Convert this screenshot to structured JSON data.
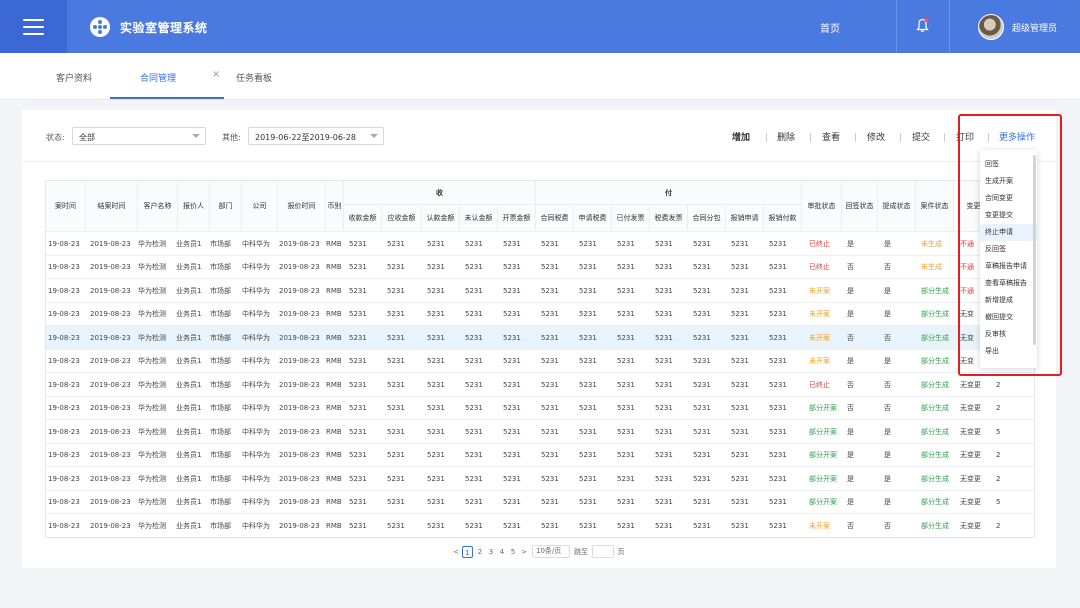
{
  "header": {
    "app_title": "实验室管理系统",
    "home": "首页",
    "user_name": "超级管理员",
    "colors": {
      "primary": "#4a7adf",
      "menu_bg": "#3b68d4",
      "accent": "#3b6fdc"
    }
  },
  "tabs": [
    {
      "label": "客户资料"
    },
    {
      "label": "合同管理",
      "active": true
    },
    {
      "label": "任务看板"
    }
  ],
  "tab_close": "×",
  "filters": {
    "status_label": "状态:",
    "status_value": "全部",
    "other_label": "其他:",
    "other_value": "2019-06-22至2019-06-28"
  },
  "actions": {
    "add": "增加",
    "delete": "删除",
    "view": "查看",
    "edit": "修改",
    "submit": "提交",
    "print": "打印",
    "more": "更多操作"
  },
  "table": {
    "columns": [
      "案时间",
      "结案时间",
      "客户名称",
      "报价人",
      "部门",
      "公司",
      "报价时间",
      "币别"
    ],
    "group_receive": "收",
    "group_pay": "付",
    "receive_columns": [
      "收款金额",
      "应收金额",
      "认款金额",
      "未认金额",
      "开票金额"
    ],
    "pay_columns": [
      "合同税费",
      "申请税费",
      "已付发票",
      "税费发票",
      "合同分包",
      "报销申请",
      "报销付款"
    ],
    "status_columns": [
      "审批状态",
      "回签状态",
      "提成状态",
      "案件状态",
      "变更"
    ],
    "rows": [
      {
        "start": "19-08-23",
        "end": "2019-08-23",
        "customer": "华为检测",
        "quoter": "业务员1",
        "dept": "市场部",
        "company": "中科华为",
        "quote_time": "2019-08-23",
        "currency": "RMB",
        "recv": [
          "5231",
          "5231",
          "5231",
          "5231",
          "5231"
        ],
        "pay": [
          "5231",
          "5231",
          "5231",
          "5231",
          "5231",
          "5231",
          "5231"
        ],
        "approval": "已终止",
        "approval_color": "red",
        "countersign": "是",
        "commission": "是",
        "case": "未生成",
        "case_color": "orange",
        "change": "不通",
        "extra": ""
      },
      {
        "start": "19-08-23",
        "end": "2019-08-23",
        "customer": "华为检测",
        "quoter": "业务员1",
        "dept": "市场部",
        "company": "中科华为",
        "quote_time": "2019-08-23",
        "currency": "RMB",
        "recv": [
          "5231",
          "5231",
          "5231",
          "5231",
          "5231"
        ],
        "pay": [
          "5231",
          "5231",
          "5231",
          "5231",
          "5231",
          "5231",
          "5231"
        ],
        "approval": "已终止",
        "approval_color": "red",
        "countersign": "否",
        "commission": "否",
        "case": "未生成",
        "case_color": "orange",
        "change": "不通",
        "extra": ""
      },
      {
        "start": "19-08-23",
        "end": "2019-08-23",
        "customer": "华为检测",
        "quoter": "业务员1",
        "dept": "市场部",
        "company": "中科华为",
        "quote_time": "2019-08-23",
        "currency": "RMB",
        "recv": [
          "5231",
          "5231",
          "5231",
          "5231",
          "5231"
        ],
        "pay": [
          "5231",
          "5231",
          "5231",
          "5231",
          "5231",
          "5231",
          "5231"
        ],
        "approval": "未开案",
        "approval_color": "orange",
        "countersign": "是",
        "commission": "是",
        "case": "部分生成",
        "case_color": "green",
        "change": "不通",
        "extra": ""
      },
      {
        "start": "19-08-23",
        "end": "2019-08-23",
        "customer": "华为检测",
        "quoter": "业务员1",
        "dept": "市场部",
        "company": "中科华为",
        "quote_time": "2019-08-23",
        "currency": "RMB",
        "recv": [
          "5231",
          "5231",
          "5231",
          "5231",
          "5231"
        ],
        "pay": [
          "5231",
          "5231",
          "5231",
          "5231",
          "5231",
          "5231",
          "5231"
        ],
        "approval": "未开案",
        "approval_color": "orange",
        "countersign": "是",
        "commission": "是",
        "case": "部分生成",
        "case_color": "green",
        "change": "无变",
        "extra": ""
      },
      {
        "start": "19-08-23",
        "end": "2019-08-23",
        "customer": "华为检测",
        "quoter": "业务员1",
        "dept": "市场部",
        "company": "中科华为",
        "quote_time": "2019-08-23",
        "currency": "RMB",
        "recv": [
          "5231",
          "5231",
          "5231",
          "5231",
          "5231"
        ],
        "pay": [
          "5231",
          "5231",
          "5231",
          "5231",
          "5231",
          "5231",
          "5231"
        ],
        "approval": "未开案",
        "approval_color": "orange",
        "countersign": "否",
        "commission": "否",
        "case": "部分生成",
        "case_color": "green",
        "change": "无变",
        "extra": ""
      },
      {
        "start": "19-08-23",
        "end": "2019-08-23",
        "customer": "华为检测",
        "quoter": "业务员1",
        "dept": "市场部",
        "company": "中科华为",
        "quote_time": "2019-08-23",
        "currency": "RMB",
        "recv": [
          "5231",
          "5231",
          "5231",
          "5231",
          "5231"
        ],
        "pay": [
          "5231",
          "5231",
          "5231",
          "5231",
          "5231",
          "5231",
          "5231"
        ],
        "approval": "未开案",
        "approval_color": "orange",
        "countersign": "是",
        "commission": "是",
        "case": "部分生成",
        "case_color": "green",
        "change": "无变",
        "extra": ""
      },
      {
        "start": "19-08-23",
        "end": "2019-08-23",
        "customer": "华为检测",
        "quoter": "业务员1",
        "dept": "市场部",
        "company": "中科华为",
        "quote_time": "2019-08-23",
        "currency": "RMB",
        "recv": [
          "5231",
          "5231",
          "5231",
          "5231",
          "5231"
        ],
        "pay": [
          "5231",
          "5231",
          "5231",
          "5231",
          "5231",
          "5231",
          "5231"
        ],
        "approval": "已终止",
        "approval_color": "red",
        "countersign": "否",
        "commission": "否",
        "case": "部分生成",
        "case_color": "green",
        "change": "无变更",
        "extra": "2"
      },
      {
        "start": "19-08-23",
        "end": "2019-08-23",
        "customer": "华为检测",
        "quoter": "业务员1",
        "dept": "市场部",
        "company": "中科华为",
        "quote_time": "2019-08-23",
        "currency": "RMB",
        "recv": [
          "5231",
          "5231",
          "5231",
          "5231",
          "5231"
        ],
        "pay": [
          "5231",
          "5231",
          "5231",
          "5231",
          "5231",
          "5231",
          "5231"
        ],
        "approval": "部分开案",
        "approval_color": "green",
        "countersign": "否",
        "commission": "否",
        "case": "部分生成",
        "case_color": "green",
        "change": "无变更",
        "extra": "2"
      },
      {
        "start": "19-08-23",
        "end": "2019-08-23",
        "customer": "华为检测",
        "quoter": "业务员1",
        "dept": "市场部",
        "company": "中科华为",
        "quote_time": "2019-08-23",
        "currency": "RMB",
        "recv": [
          "5231",
          "5231",
          "5231",
          "5231",
          "5231"
        ],
        "pay": [
          "5231",
          "5231",
          "5231",
          "5231",
          "5231",
          "5231",
          "5231"
        ],
        "approval": "部分开案",
        "approval_color": "green",
        "countersign": "是",
        "commission": "是",
        "case": "部分生成",
        "case_color": "green",
        "change": "无变更",
        "extra": "5"
      },
      {
        "start": "19-08-23",
        "end": "2019-08-23",
        "customer": "华为检测",
        "quoter": "业务员1",
        "dept": "市场部",
        "company": "中科华为",
        "quote_time": "2019-08-23",
        "currency": "RMB",
        "recv": [
          "5231",
          "5231",
          "5231",
          "5231",
          "5231"
        ],
        "pay": [
          "5231",
          "5231",
          "5231",
          "5231",
          "5231",
          "5231",
          "5231"
        ],
        "approval": "部分开案",
        "approval_color": "green",
        "countersign": "是",
        "commission": "是",
        "case": "部分生成",
        "case_color": "green",
        "change": "无变更",
        "extra": "2"
      },
      {
        "start": "19-08-23",
        "end": "2019-08-23",
        "customer": "华为检测",
        "quoter": "业务员1",
        "dept": "市场部",
        "company": "中科华为",
        "quote_time": "2019-08-23",
        "currency": "RMB",
        "recv": [
          "5231",
          "5231",
          "5231",
          "5231",
          "5231"
        ],
        "pay": [
          "5231",
          "5231",
          "5231",
          "5231",
          "5231",
          "5231",
          "5231"
        ],
        "approval": "部分开案",
        "approval_color": "green",
        "countersign": "是",
        "commission": "是",
        "case": "部分生成",
        "case_color": "green",
        "change": "无变更",
        "extra": "2"
      },
      {
        "start": "19-08-23",
        "end": "2019-08-23",
        "customer": "华为检测",
        "quoter": "业务员1",
        "dept": "市场部",
        "company": "中科华为",
        "quote_time": "2019-08-23",
        "currency": "RMB",
        "recv": [
          "5231",
          "5231",
          "5231",
          "5231",
          "5231"
        ],
        "pay": [
          "5231",
          "5231",
          "5231",
          "5231",
          "5231",
          "5231",
          "5231"
        ],
        "approval": "部分开案",
        "approval_color": "green",
        "countersign": "是",
        "commission": "是",
        "case": "部分生成",
        "case_color": "green",
        "change": "无变更",
        "extra": "5"
      },
      {
        "start": "19-08-23",
        "end": "2019-08-23",
        "customer": "华为检测",
        "quoter": "业务员1",
        "dept": "市场部",
        "company": "中科华为",
        "quote_time": "2019-08-23",
        "currency": "RMB",
        "recv": [
          "5231",
          "5231",
          "5231",
          "5231",
          "5231"
        ],
        "pay": [
          "5231",
          "5231",
          "5231",
          "5231",
          "5231",
          "5231",
          "5231"
        ],
        "approval": "未开案",
        "approval_color": "orange",
        "countersign": "否",
        "commission": "否",
        "case": "部分生成",
        "case_color": "green",
        "change": "无变更",
        "extra": "2"
      }
    ]
  },
  "pagination": {
    "prev": "<",
    "pages": [
      "1",
      "2",
      "3",
      "4",
      "5"
    ],
    "current": "1",
    "next": ">",
    "per_page": "10条/页",
    "goto_label": "跳至",
    "goto_suffix": "页"
  },
  "more_menu": {
    "items": [
      "回签",
      "生成开案",
      "合同变更",
      "变更提交",
      "终止申请",
      "反回签",
      "草稿报告申请",
      "查看草稿报告",
      "新增提成",
      "撤回提交",
      "反审核",
      "导出"
    ],
    "highlighted": "终止申请"
  }
}
